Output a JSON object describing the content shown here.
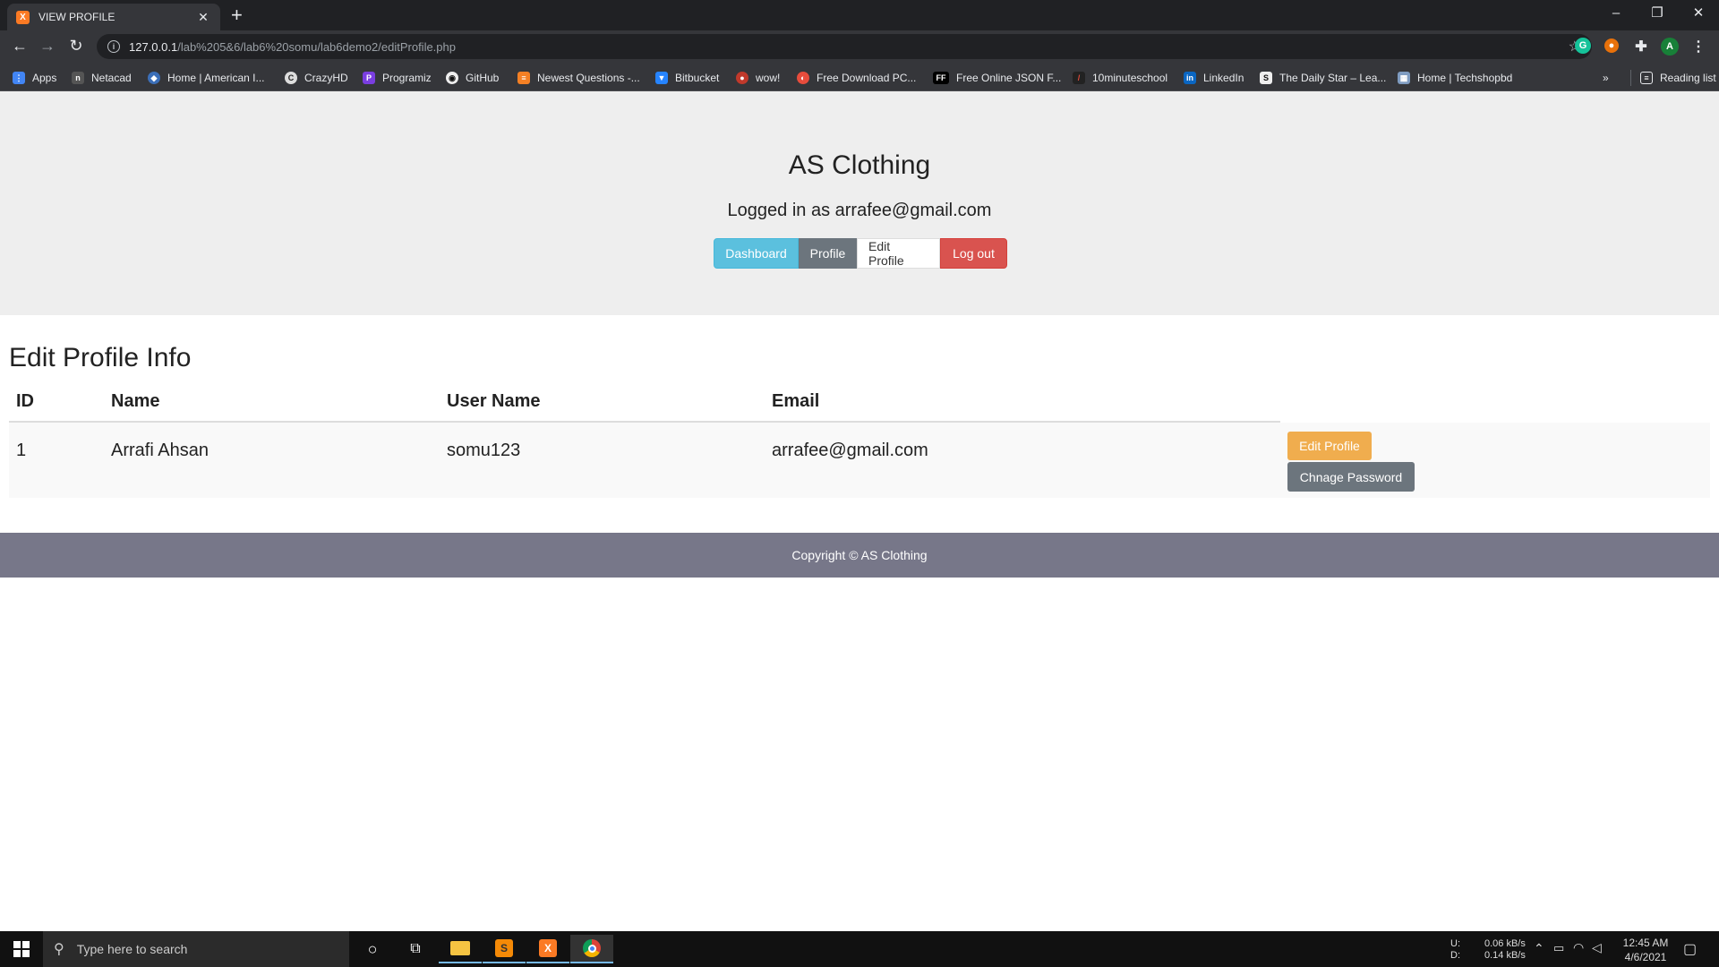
{
  "browser": {
    "tab_title": "VIEW PROFILE",
    "url_host": "127.0.0.1",
    "url_path": "/lab%205&6/lab6%20somu/lab6demo2/editProfile.php",
    "profile_initial": "A",
    "bookmarks": [
      {
        "label": "Apps"
      },
      {
        "label": "Netacad"
      },
      {
        "label": "Home | American I..."
      },
      {
        "label": "CrazyHD"
      },
      {
        "label": "Programiz"
      },
      {
        "label": "GitHub"
      },
      {
        "label": "Newest Questions -..."
      },
      {
        "label": "Bitbucket"
      },
      {
        "label": "wow!"
      },
      {
        "label": "Free Download PC..."
      },
      {
        "label": "Free Online JSON F..."
      },
      {
        "label": "10minuteschool"
      },
      {
        "label": "LinkedIn"
      },
      {
        "label": "The Daily Star – Lea..."
      },
      {
        "label": "Home | Techshopbd"
      }
    ],
    "more_bookmarks": "»",
    "reading_list": "Reading list"
  },
  "header": {
    "site_title": "AS Clothing",
    "logged_in": "Logged in as arrafee@gmail.com",
    "nav": {
      "dashboard": "Dashboard",
      "profile": "Profile",
      "edit_profile": "Edit Profile",
      "logout": "Log out"
    }
  },
  "main": {
    "section_title": "Edit Profile Info",
    "table": {
      "headers": [
        "ID",
        "Name",
        "User Name",
        "Email"
      ],
      "rows": [
        {
          "id": "1",
          "name": "Arrafi Ahsan",
          "username": "somu123",
          "email": "arrafee@gmail.com"
        }
      ],
      "edit_button": "Edit Profile",
      "password_button": "Chnage Password"
    }
  },
  "footer": {
    "text": "Copyright © AS Clothing"
  },
  "taskbar": {
    "search_placeholder": "Type here to search",
    "net_up_label": "U:",
    "net_down_label": "D:",
    "net_up": "0.06 kB/s",
    "net_down": "0.14 kB/s",
    "time": "12:45 AM",
    "date": "4/6/2021"
  },
  "colors": {
    "dashboard": "#5bc0de",
    "profile": "#6c757d",
    "logout": "#d9534f",
    "edit_button": "#f0ad4e",
    "footer": "#777789"
  }
}
